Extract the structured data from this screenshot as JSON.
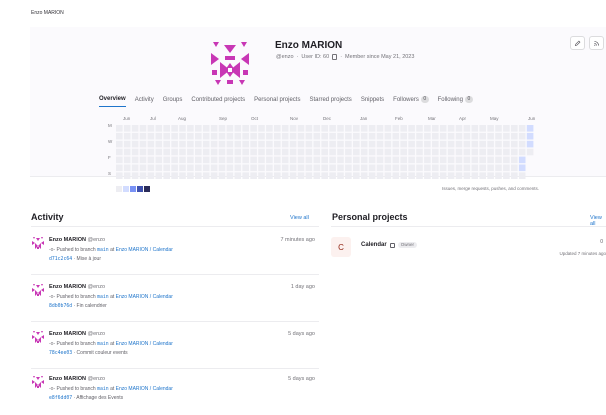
{
  "breadcrumb": "Enzo MARION",
  "profile": {
    "name": "Enzo MARION",
    "handle": "@enzo",
    "sep": "·",
    "user_id": "User ID: 60",
    "member_since": "Member since May 21, 2023"
  },
  "header_buttons": [
    {
      "icon": "pencil-icon"
    },
    {
      "icon": "rss-icon"
    }
  ],
  "tabs": [
    {
      "label": "Overview",
      "active": true
    },
    {
      "label": "Activity"
    },
    {
      "label": "Groups"
    },
    {
      "label": "Contributed projects"
    },
    {
      "label": "Personal projects"
    },
    {
      "label": "Starred projects"
    },
    {
      "label": "Snippets"
    },
    {
      "label": "Followers",
      "count": "0"
    },
    {
      "label": "Following",
      "count": "0"
    }
  ],
  "calendar": {
    "months": [
      "Jun",
      "Jul",
      "Aug",
      "Sep",
      "Oct",
      "Nov",
      "Dec",
      "Jan",
      "Feb",
      "Mar",
      "Apr",
      "May",
      "Jun"
    ],
    "days": [
      "M",
      "W",
      "F",
      "S"
    ],
    "note": "Issues, merge requests, pushes, and comments.",
    "colors": {
      "empty": "#ededf2",
      "low": "#d2dcff",
      "mid": "#7992f5",
      "high": "#3f51ae",
      "max": "#2a2b59"
    }
  },
  "activity": {
    "title": "Activity",
    "view_all": "View all",
    "items": [
      {
        "author": "Enzo MARION",
        "handle": "@enzo",
        "time": "7 minutes ago",
        "action": "Pushed to branch",
        "branch": "main",
        "at": "at",
        "project": "Enzo MARION / Calendar",
        "sha": "d71c2c64",
        "message": "· Mise à jour"
      },
      {
        "author": "Enzo MARION",
        "handle": "@enzo",
        "time": "1 day ago",
        "action": "Pushed to branch",
        "branch": "main",
        "at": "at",
        "project": "Enzo MARION / Calendar",
        "sha": "8db0b76d",
        "message": "· Fin calendrier"
      },
      {
        "author": "Enzo MARION",
        "handle": "@enzo",
        "time": "5 days ago",
        "action": "Pushed to branch",
        "branch": "main",
        "at": "at",
        "project": "Enzo MARION / Calendar",
        "sha": "78c4ee03",
        "message": "· Commit couleur events"
      },
      {
        "author": "Enzo MARION",
        "handle": "@enzo",
        "time": "5 days ago",
        "action": "Pushed to branch",
        "branch": "main",
        "at": "at",
        "project": "Enzo MARION / Calendar",
        "sha": "e8f6dd07",
        "message": "· Affichage des Events"
      }
    ]
  },
  "personal_projects": {
    "title": "Personal projects",
    "view_all": "View all",
    "items": [
      {
        "initial": "C",
        "name": "Calendar",
        "role": "Owner",
        "stars": "0",
        "updated": "Updated 7 minutes ago"
      }
    ]
  }
}
